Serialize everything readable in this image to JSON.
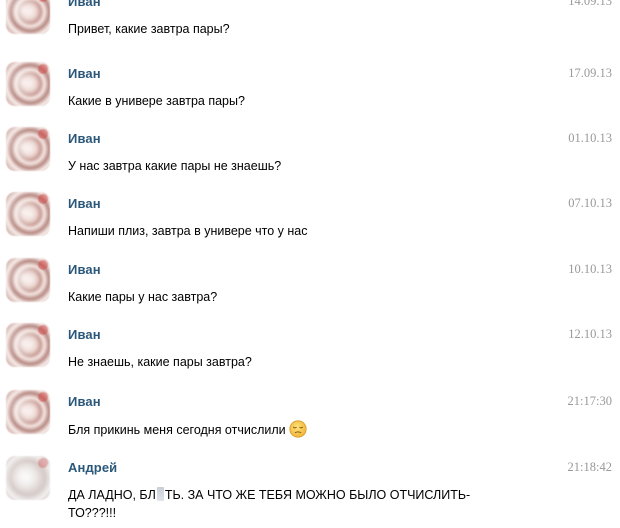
{
  "messages": [
    {
      "author": "Иван",
      "date": "14.09.13",
      "text": "Привет, какие завтра пары?"
    },
    {
      "author": "Иван",
      "date": "17.09.13",
      "text": "Какие в универе завтра пары?"
    },
    {
      "author": "Иван",
      "date": "01.10.13",
      "text": "У нас завтра какие пары не знаешь?"
    },
    {
      "author": "Иван",
      "date": "07.10.13",
      "text": "Напиши плиз, завтра в универе что у нас"
    },
    {
      "author": "Иван",
      "date": "10.10.13",
      "text": "Какие пары у нас завтра?"
    },
    {
      "author": "Иван",
      "date": "12.10.13",
      "text": "Не знаешь, какие пары завтра?"
    },
    {
      "author": "Иван",
      "date": "21:17:30",
      "text": "Бля прикинь меня сегодня отчислили",
      "emoji": "pensive-face-icon"
    },
    {
      "author": "Андрей",
      "date": "21:18:42",
      "text_before": "ДА ЛАДНО, БЛ",
      "text_after": "ТЬ. ЗА ЧТО ЖЕ ТЕБЯ МОЖНО БЫЛО ОТЧИСЛИТЬ-",
      "text_line2": "ТО???!!!"
    }
  ],
  "colors": {
    "author": "#2b587a",
    "date": "#999999",
    "text": "#000000",
    "background": "#ffffff"
  }
}
